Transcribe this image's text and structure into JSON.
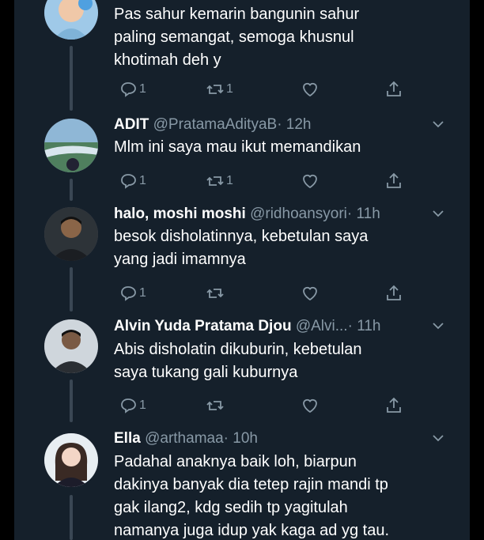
{
  "colors": {
    "background": "#15202b",
    "text": "#ffffff",
    "muted": "#8899a6",
    "thread_line": "#3a4754"
  },
  "tweets": [
    {
      "name": "",
      "handle": "",
      "time": "",
      "lines": [
        "Pas sahur kemarin bangunin sahur",
        "paling semangat, semoga khusnul",
        "khotimah deh y"
      ],
      "replies": "1",
      "retweets": "1",
      "avatar_icon": "child-avatar"
    },
    {
      "name": "ADIT",
      "handle": "@PratamaAdityaB",
      "time": "· 12h",
      "lines": [
        "Mlm ini saya mau ikut memandikan"
      ],
      "replies": "1",
      "retweets": "1",
      "avatar_icon": "landscape-avatar"
    },
    {
      "name": "halo, moshi moshi",
      "handle": "@ridhoansyori",
      "time": "· 11h",
      "lines": [
        "besok disholatinnya, kebetulan saya",
        "yang jadi imamnya"
      ],
      "replies": "1",
      "retweets": "",
      "avatar_icon": "man-avatar"
    },
    {
      "name": "Alvin Yuda Pratama Djou",
      "handle": "@Alvi...",
      "time": "· 11h",
      "lines": [
        "Abis disholatin dikuburin, kebetulan",
        "saya tukang gali kuburnya"
      ],
      "replies": "1",
      "retweets": "",
      "avatar_icon": "man-avatar"
    },
    {
      "name": "Ella",
      "handle": "@arthamaa",
      "time": "· 10h",
      "lines": [
        "Padahal anaknya baik loh, biarpun",
        "dakinya banyak dia tetep rajin mandi tp",
        "gak ilang2, kdg sedih tp yagitulah",
        "namanya juga idup yak kaga ad yg tau."
      ],
      "replies": "",
      "retweets": "",
      "avatar_icon": "girl-avatar"
    }
  ]
}
